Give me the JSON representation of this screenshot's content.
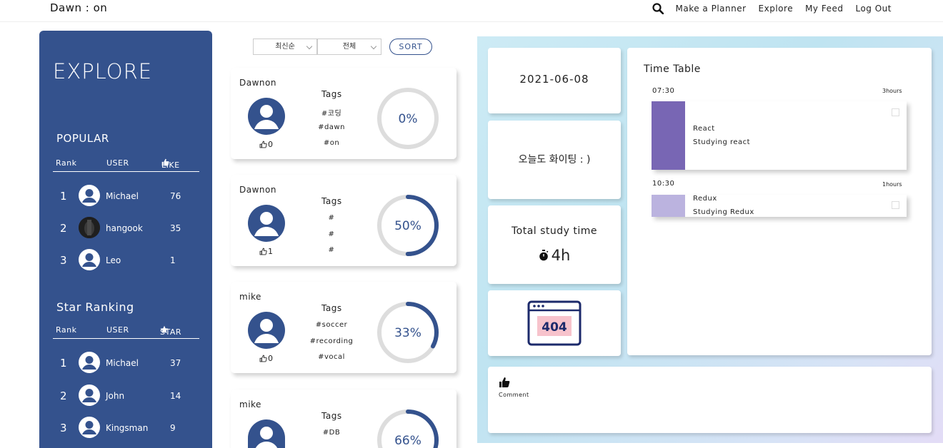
{
  "header": {
    "brand": "Dawn : on",
    "nav": [
      "Make a Planner",
      "Explore",
      "My Feed",
      "Log Out"
    ]
  },
  "sidebar": {
    "title": "EXPLORE",
    "popular": {
      "title": "POPULAR",
      "headers": {
        "rank": "Rank",
        "user": "USER",
        "metric": "LIKE"
      },
      "rows": [
        {
          "rank": "1",
          "name": "Michael",
          "count": "76"
        },
        {
          "rank": "2",
          "name": "hangook",
          "count": "35"
        },
        {
          "rank": "3",
          "name": "Leo",
          "count": "1"
        }
      ]
    },
    "stars": {
      "title": "Star Ranking",
      "headers": {
        "rank": "Rank",
        "user": "USER",
        "metric": "STAR"
      },
      "rows": [
        {
          "rank": "1",
          "name": "Michael",
          "count": "37"
        },
        {
          "rank": "2",
          "name": "John",
          "count": "14"
        },
        {
          "rank": "3",
          "name": "Kingsman",
          "count": "9"
        }
      ]
    }
  },
  "filters": {
    "order": "최신순",
    "scope": "전체",
    "sort_label": "SORT"
  },
  "feed": [
    {
      "user": "Dawnon",
      "likes": "0",
      "tags_title": "Tags",
      "tags": [
        "#코딩",
        "#dawn",
        "#on"
      ],
      "progress": 0,
      "progress_label": "0%"
    },
    {
      "user": "Dawnon",
      "likes": "1",
      "tags_title": "Tags",
      "tags": [
        "#",
        "#",
        "#"
      ],
      "progress": 50,
      "progress_label": "50%"
    },
    {
      "user": "mike",
      "likes": "0",
      "tags_title": "Tags",
      "tags": [
        "#soccer",
        "#recording",
        "#vocal"
      ],
      "progress": 33,
      "progress_label": "33%"
    },
    {
      "user": "mike",
      "likes": "",
      "tags_title": "Tags",
      "tags": [
        "#DB",
        "",
        ""
      ],
      "progress": 66,
      "progress_label": "66%"
    }
  ],
  "detail": {
    "date": "2021-06-08",
    "message": "오늘도 화이팅 : )",
    "study_title": "Total study time",
    "study_value": "4h",
    "image_text": "404",
    "comment_label": "Comment",
    "timetable": {
      "title": "Time Table",
      "entries": [
        {
          "time": "07:30",
          "duration": "3hours",
          "title": "React",
          "desc": "Studying react",
          "color": "#7866b4"
        },
        {
          "time": "10:30",
          "duration": "1hours",
          "title": "Redux",
          "desc": "Studying Redux",
          "color": "#bbb3df"
        }
      ]
    }
  },
  "colors": {
    "primary": "#34528d",
    "ring_track": "#dddddd"
  }
}
